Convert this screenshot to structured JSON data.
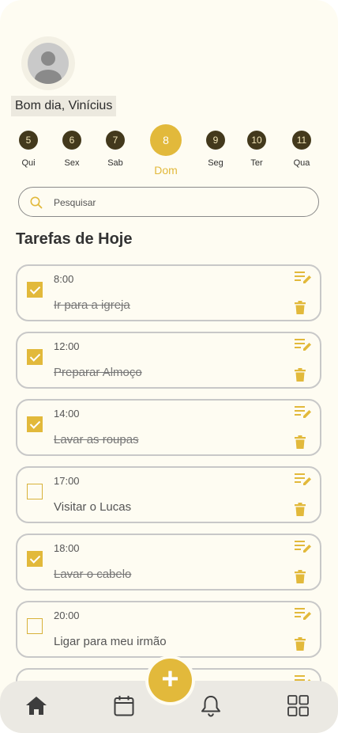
{
  "user": {
    "greeting": "Bom dia, Vinícius"
  },
  "week": [
    {
      "num": "5",
      "label": "Qui",
      "active": false
    },
    {
      "num": "6",
      "label": "Sex",
      "active": false
    },
    {
      "num": "7",
      "label": "Sab",
      "active": false
    },
    {
      "num": "8",
      "label": "Dom",
      "active": true
    },
    {
      "num": "9",
      "label": "Seg",
      "active": false
    },
    {
      "num": "10",
      "label": "Ter",
      "active": false
    },
    {
      "num": "11",
      "label": "Qua",
      "active": false
    }
  ],
  "search": {
    "placeholder": "Pesquisar"
  },
  "section": {
    "title": "Tarefas de Hoje"
  },
  "tasks": [
    {
      "time": "8:00",
      "text": "Ir para a igreja",
      "done": true
    },
    {
      "time": "12:00",
      "text": "Preparar Almoço",
      "done": true
    },
    {
      "time": "14:00",
      "text": "Lavar as roupas",
      "done": true
    },
    {
      "time": "17:00",
      "text": "Visitar o Lucas",
      "done": false
    },
    {
      "time": "18:00",
      "text": "Lavar o cabelo",
      "done": true
    },
    {
      "time": "20:00",
      "text": "Ligar para meu irmão",
      "done": false
    }
  ],
  "colors": {
    "accent": "#e2b93b",
    "dark": "#43391c",
    "background": "#fefcf2"
  },
  "nav": [
    "home-icon",
    "calendar-icon",
    "bell-icon",
    "grid-icon"
  ],
  "fab": {
    "label": "+"
  }
}
